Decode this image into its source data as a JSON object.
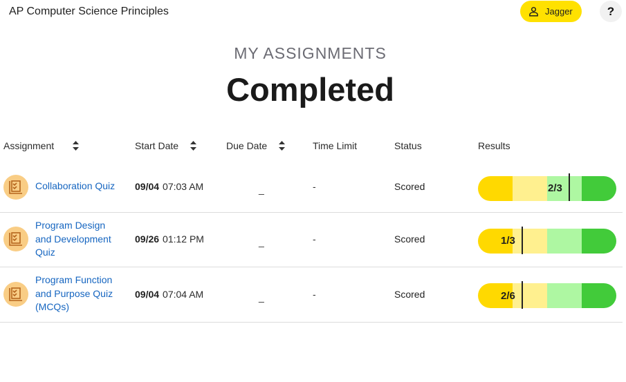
{
  "header": {
    "app_title": "AP Computer Science Principles",
    "user_name": "Jagger",
    "help_label": "?"
  },
  "page": {
    "subtitle": "MY ASSIGNMENTS",
    "title": "Completed"
  },
  "table": {
    "columns": {
      "assignment": "Assignment",
      "start_date": "Start Date",
      "due_date": "Due Date",
      "time_limit": "Time Limit",
      "status": "Status",
      "results": "Results"
    },
    "rows": [
      {
        "name": "Collaboration Quiz",
        "start_day": "09/04",
        "start_time": "07:03 AM",
        "due": "_",
        "time_limit": "-",
        "status": "Scored",
        "score": "2/3",
        "score_fraction": 0.667
      },
      {
        "name": "Program Design and Development Quiz",
        "start_day": "09/26",
        "start_time": "01:12 PM",
        "due": "_",
        "time_limit": "-",
        "status": "Scored",
        "score": "1/3",
        "score_fraction": 0.333
      },
      {
        "name": "Program Function and Purpose Quiz (MCQs)",
        "start_day": "09/04",
        "start_time": "07:04 AM",
        "due": "_",
        "time_limit": "-",
        "status": "Scored",
        "score": "2/6",
        "score_fraction": 0.333
      }
    ]
  },
  "colors": {
    "accent_yellow": "#ffe100",
    "link_blue": "#1565c0",
    "result_segments": [
      "#ffd900",
      "#fff08f",
      "#aef7a2",
      "#42cb3a"
    ],
    "quiz_icon_bg": "#f9cd85"
  },
  "icons": {
    "user": "person-icon",
    "sort": "sort-icon",
    "quiz": "quiz-checklist-icon"
  }
}
